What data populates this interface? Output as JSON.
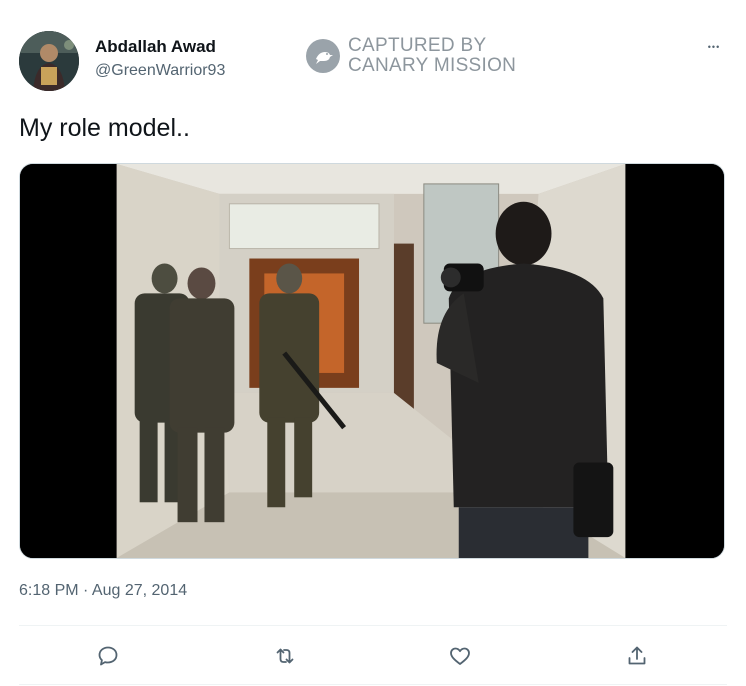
{
  "tweet": {
    "author": {
      "display_name": "Abdallah Awad",
      "handle": "@GreenWarrior93",
      "avatar_icon": "profile-photo"
    },
    "watermark": {
      "line1": "CAPTURED BY",
      "line2": "CANARY MISSION",
      "icon": "canary-bird-icon"
    },
    "more_icon": "more-dots-icon",
    "more_glyph": "•••",
    "text": "My role model..",
    "media": {
      "type": "photo"
    },
    "timestamp": "6:18 PM · Aug 27, 2014",
    "actions": [
      {
        "name": "reply",
        "icon": "reply-icon"
      },
      {
        "name": "retweet",
        "icon": "retweet-icon"
      },
      {
        "name": "like",
        "icon": "like-icon"
      },
      {
        "name": "share",
        "icon": "share-icon"
      }
    ]
  },
  "colors": {
    "text_primary": "#0f1419",
    "text_secondary": "#536471",
    "divider": "#eff3f4",
    "watermark": "#9aa3aa"
  }
}
